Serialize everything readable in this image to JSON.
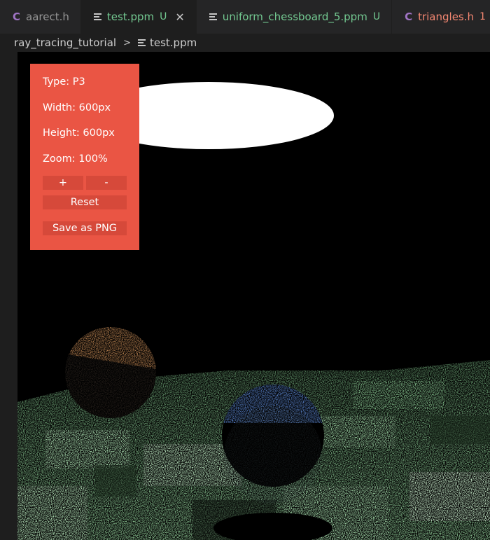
{
  "tabs": [
    {
      "icon": "C",
      "label": "aarect.h",
      "badge": "",
      "active": false
    },
    {
      "label": "test.ppm",
      "badge": "U",
      "active": true
    },
    {
      "label": "uniform_chessboard_5.ppm",
      "badge": "U",
      "active": false
    },
    {
      "icon": "C",
      "label": "triangles.h",
      "badge": "1",
      "active": false
    }
  ],
  "breadcrumb": {
    "folder": "ray_tracing_tutorial",
    "separator": ">",
    "file": "test.ppm"
  },
  "viewer_panel": {
    "type": "Type: P3",
    "width": "Width: 600px",
    "height": "Height: 600px",
    "zoom": "Zoom: 100%",
    "zoom_in": "+",
    "zoom_out": "-",
    "reset": "Reset",
    "save": "Save as PNG"
  },
  "colors": {
    "panel_bg": "#ea5544",
    "light_fill": "#ffffff",
    "floor_green": "#7fc58a",
    "sphere_orange": "#e79a55",
    "sphere_blue": "#5b86cf"
  }
}
